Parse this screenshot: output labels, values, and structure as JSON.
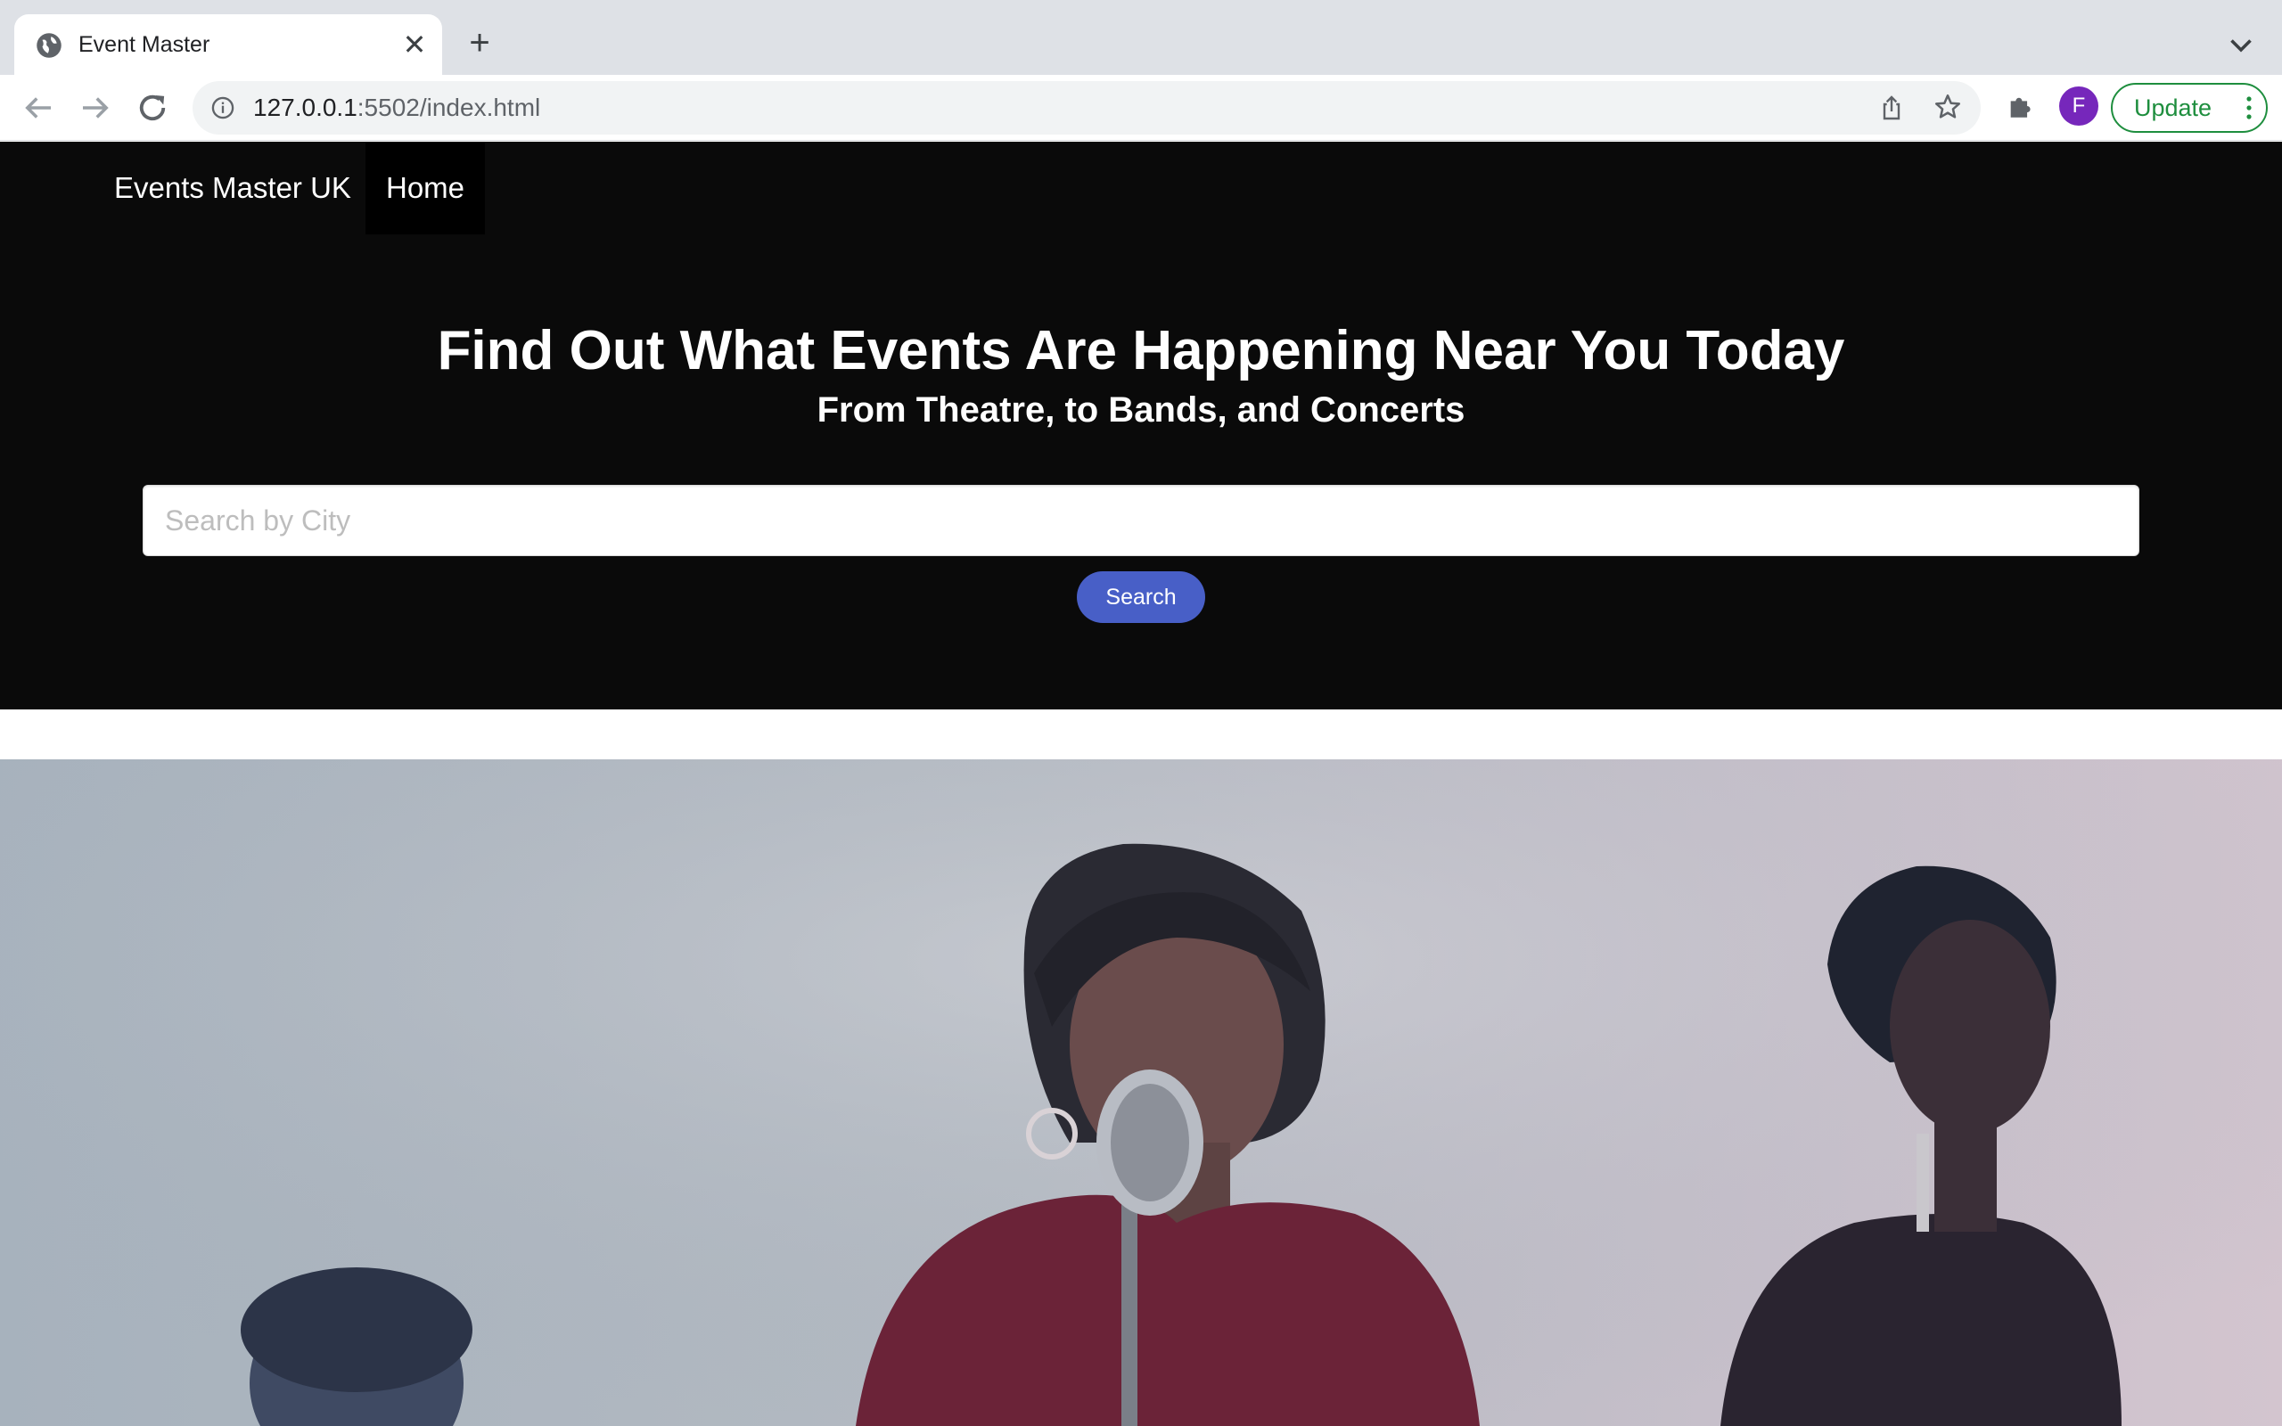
{
  "browser": {
    "tab_title": "Event Master",
    "url_host": "127.0.0.1",
    "url_path": ":5502/index.html",
    "profile_initial": "F",
    "update_label": "Update",
    "icons": [
      "globe-icon",
      "close-icon",
      "plus-icon",
      "chevron-down-icon",
      "back-arrow-icon",
      "forward-arrow-icon",
      "reload-icon",
      "info-icon",
      "share-icon",
      "star-icon",
      "puzzle-icon",
      "more-vert-icon"
    ]
  },
  "nav": {
    "brand": "Events Master UK",
    "home": "Home"
  },
  "hero": {
    "title": "Find Out What Events Are Happening Near You Today",
    "subtitle": "From Theatre, to Bands, and Concerts",
    "search_placeholder": "Search by City",
    "search_button": "Search"
  },
  "colors": {
    "hero_bg": "#0a0a0a",
    "button_primary": "#485fc7",
    "update_green": "#1e8e3e",
    "avatar_purple": "#7627bb"
  }
}
